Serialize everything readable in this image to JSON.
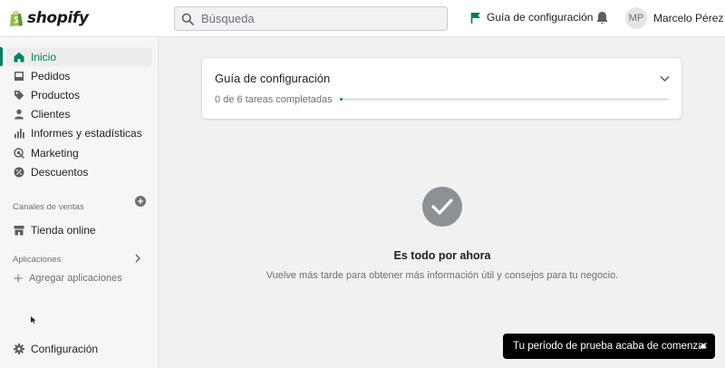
{
  "brand": {
    "name": "shopify",
    "color": "#95bf47"
  },
  "search": {
    "placeholder": "Búsqueda"
  },
  "header": {
    "setup_guide_label": "Guía de configuración",
    "user": {
      "initials": "MP",
      "name": "Marcelo Pérez"
    }
  },
  "sidebar": {
    "items": [
      {
        "label": "Inicio",
        "icon": "home-icon",
        "active": true
      },
      {
        "label": "Pedidos",
        "icon": "orders-icon"
      },
      {
        "label": "Productos",
        "icon": "tag-icon"
      },
      {
        "label": "Clientes",
        "icon": "person-icon"
      },
      {
        "label": "Informes y estadísticas",
        "icon": "analytics-icon"
      },
      {
        "label": "Marketing",
        "icon": "target-icon"
      },
      {
        "label": "Descuentos",
        "icon": "discount-icon"
      }
    ],
    "sales_channels_title": "Canales de ventas",
    "online_store_label": "Tienda online",
    "apps_title": "Aplicaciones",
    "add_apps_label": "Agregar aplicaciones",
    "settings_label": "Configuración"
  },
  "setup_card": {
    "title": "Guía de configuración",
    "progress_text": "0 de 6 tareas completadas",
    "completed": 0,
    "total": 6
  },
  "empty_state": {
    "title": "Es todo por ahora",
    "subtitle": "Vuelve más tarde para obtener más información útil y consejos para tu negocio."
  },
  "trial_toast": {
    "label": "Tu período de prueba acaba de comenzar"
  },
  "colors": {
    "accent": "#008060",
    "toast_bg": "#000000"
  }
}
